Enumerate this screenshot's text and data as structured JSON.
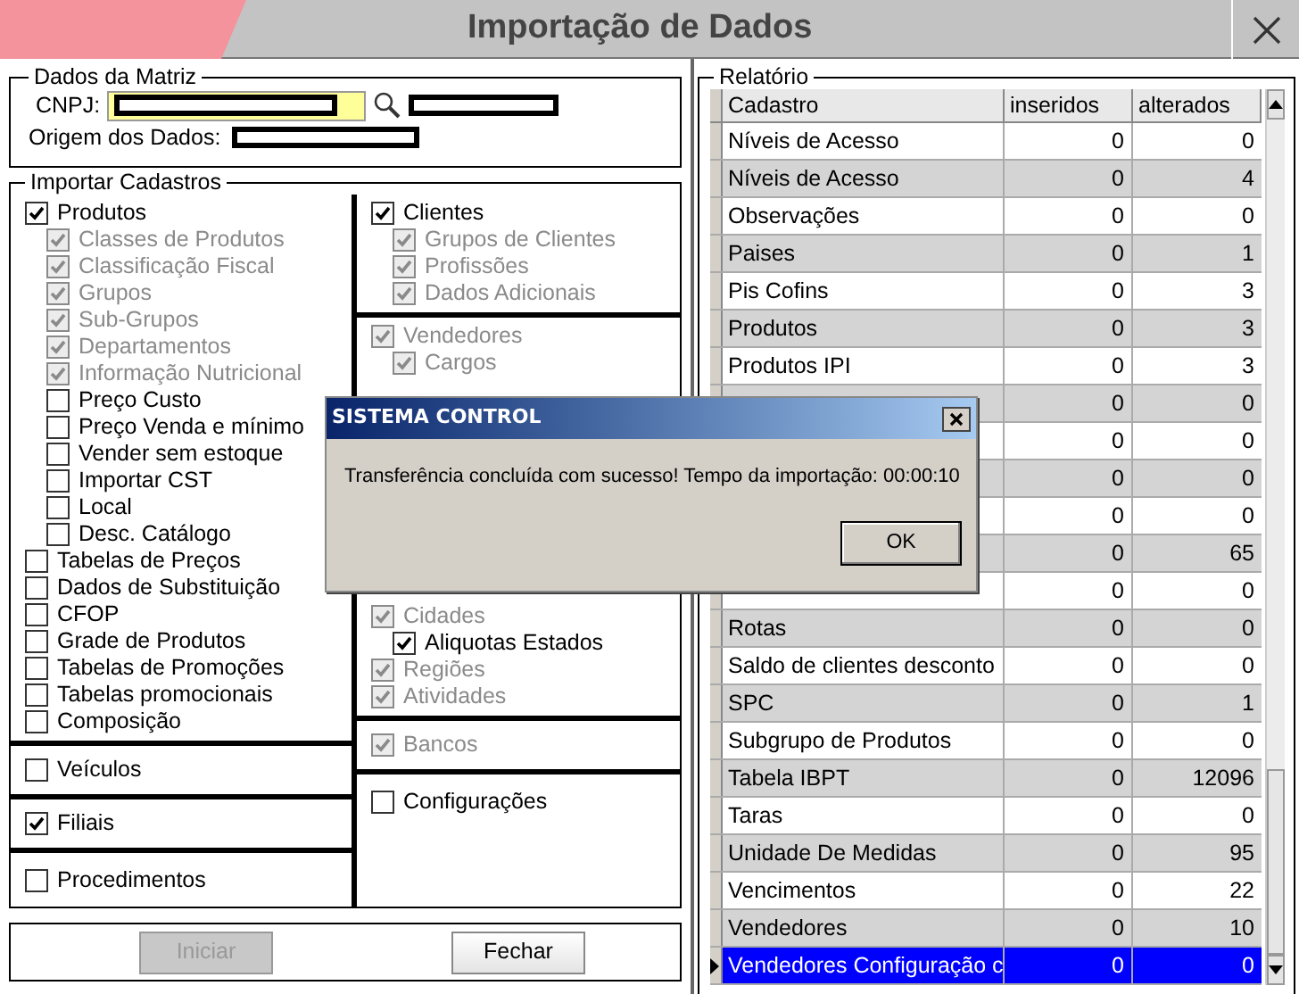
{
  "window": {
    "title": "Importação de Dados"
  },
  "dados_matriz": {
    "title": "Dados da Matriz",
    "cnpj_label": "CNPJ:",
    "origem_label": "Origem dos Dados:"
  },
  "importar_cadastros": {
    "title": "Importar Cadastros",
    "left_groups": [
      {
        "items": [
          {
            "label": "Produtos",
            "checked": true,
            "disabled": false,
            "children": [
              {
                "label": "Classes de Produtos",
                "checked": true,
                "disabled": true
              },
              {
                "label": "Classificação Fiscal",
                "checked": true,
                "disabled": true
              },
              {
                "label": "Grupos",
                "checked": true,
                "disabled": true
              },
              {
                "label": "Sub-Grupos",
                "checked": true,
                "disabled": true
              },
              {
                "label": "Departamentos",
                "checked": true,
                "disabled": true
              },
              {
                "label": "Informação Nutricional",
                "checked": true,
                "disabled": true
              },
              {
                "label": "Preço Custo",
                "checked": false,
                "disabled": false
              },
              {
                "label": "Preço Venda e mínimo",
                "checked": false,
                "disabled": false
              },
              {
                "label": "Vender sem estoque",
                "checked": false,
                "disabled": false
              },
              {
                "label": "Importar CST",
                "checked": false,
                "disabled": false
              },
              {
                "label": "Local",
                "checked": false,
                "disabled": false
              },
              {
                "label": "Desc. Catálogo",
                "checked": false,
                "disabled": false
              }
            ]
          },
          {
            "label": "Tabelas de Preços",
            "checked": false,
            "disabled": false
          },
          {
            "label": "Dados de Substituição",
            "checked": false,
            "disabled": false
          },
          {
            "label": "CFOP",
            "checked": false,
            "disabled": false
          },
          {
            "label": "Grade de Produtos",
            "checked": false,
            "disabled": false
          },
          {
            "label": "Tabelas de Promoções",
            "checked": false,
            "disabled": false
          },
          {
            "label": "Tabelas promocionais",
            "checked": false,
            "disabled": false
          },
          {
            "label": "Composição",
            "checked": false,
            "disabled": false
          }
        ]
      },
      {
        "items": [
          {
            "label": "Veículos",
            "checked": false,
            "disabled": false
          }
        ]
      },
      {
        "items": [
          {
            "label": "Filiais",
            "checked": true,
            "disabled": false
          }
        ]
      },
      {
        "items": [
          {
            "label": "Procedimentos",
            "checked": false,
            "disabled": false
          }
        ]
      }
    ],
    "right_groups": [
      {
        "items": [
          {
            "label": "Clientes",
            "checked": true,
            "disabled": false,
            "children": [
              {
                "label": "Grupos de Clientes",
                "checked": true,
                "disabled": true
              },
              {
                "label": "Profissões",
                "checked": true,
                "disabled": true
              },
              {
                "label": "Dados Adicionais",
                "checked": true,
                "disabled": true
              }
            ]
          }
        ]
      },
      {
        "items": [
          {
            "label": "Vendedores",
            "checked": true,
            "disabled": true,
            "children": [
              {
                "label": "Cargos",
                "checked": true,
                "disabled": true
              }
            ]
          },
          {
            "label": "Cidades",
            "checked": true,
            "disabled": true,
            "children": [
              {
                "label": "Aliquotas Estados",
                "checked": true,
                "disabled": false
              }
            ]
          },
          {
            "label": "Regiões",
            "checked": true,
            "disabled": true
          },
          {
            "label": "Atividades",
            "checked": true,
            "disabled": true
          }
        ]
      },
      {
        "items": [
          {
            "label": "Bancos",
            "checked": true,
            "disabled": true
          }
        ]
      },
      {
        "items": [
          {
            "label": "Configurações",
            "checked": false,
            "disabled": false
          }
        ]
      }
    ]
  },
  "buttons": [
    {
      "label": "Iniciar",
      "disabled": true
    },
    {
      "label": "Fechar",
      "disabled": false
    }
  ],
  "relatorio": {
    "title": "Relatório",
    "columns": [
      "Cadastro",
      "inseridos",
      "alterados"
    ],
    "rows": [
      {
        "cadastro": "Níveis de Acesso",
        "inseridos": "0",
        "alterados": "0",
        "selected": false
      },
      {
        "cadastro": "Níveis de Acesso",
        "inseridos": "0",
        "alterados": "4",
        "selected": false
      },
      {
        "cadastro": "Observações",
        "inseridos": "0",
        "alterados": "0",
        "selected": false
      },
      {
        "cadastro": "Paises",
        "inseridos": "0",
        "alterados": "1",
        "selected": false
      },
      {
        "cadastro": "Pis Cofins",
        "inseridos": "0",
        "alterados": "3",
        "selected": false
      },
      {
        "cadastro": "Produtos",
        "inseridos": "0",
        "alterados": "3",
        "selected": false
      },
      {
        "cadastro": "Produtos IPI",
        "inseridos": "0",
        "alterados": "3",
        "selected": false
      },
      {
        "inseridos": "0",
        "alterados": "0",
        "selected": false
      },
      {
        "inseridos": "0",
        "alterados": "0",
        "selected": false
      },
      {
        "inseridos": "0",
        "alterados": "0",
        "selected": false
      },
      {
        "inseridos": "0",
        "alterados": "0",
        "selected": false
      },
      {
        "inseridos": "0",
        "alterados": "65",
        "selected": false
      },
      {
        "inseridos": "0",
        "alterados": "0",
        "selected": false
      },
      {
        "cadastro": "Rotas",
        "inseridos": "0",
        "alterados": "0",
        "selected": false
      },
      {
        "cadastro": "Saldo de clientes desconto",
        "inseridos": "0",
        "alterados": "0",
        "selected": false
      },
      {
        "cadastro": "SPC",
        "inseridos": "0",
        "alterados": "1",
        "selected": false
      },
      {
        "cadastro": "Subgrupo de Produtos",
        "inseridos": "0",
        "alterados": "0",
        "selected": false
      },
      {
        "cadastro": "Tabela IBPT",
        "inseridos": "0",
        "alterados": "12096",
        "selected": false
      },
      {
        "cadastro": "Taras",
        "inseridos": "0",
        "alterados": "0",
        "selected": false
      },
      {
        "cadastro": "Unidade De Medidas",
        "inseridos": "0",
        "alterados": "95",
        "selected": false
      },
      {
        "cadastro": "Vencimentos",
        "inseridos": "0",
        "alterados": "22",
        "selected": false
      },
      {
        "cadastro": "Vendedores",
        "inseridos": "0",
        "alterados": "10",
        "selected": false
      },
      {
        "cadastro": "Vendedores Configuração c",
        "inseridos": "0",
        "alterados": "0",
        "selected": true
      }
    ]
  },
  "dialog": {
    "title": "SISTEMA CONTROL",
    "message": "Transferência concluída com sucesso! Tempo da importação: 00:00:10",
    "button": "OK"
  }
}
